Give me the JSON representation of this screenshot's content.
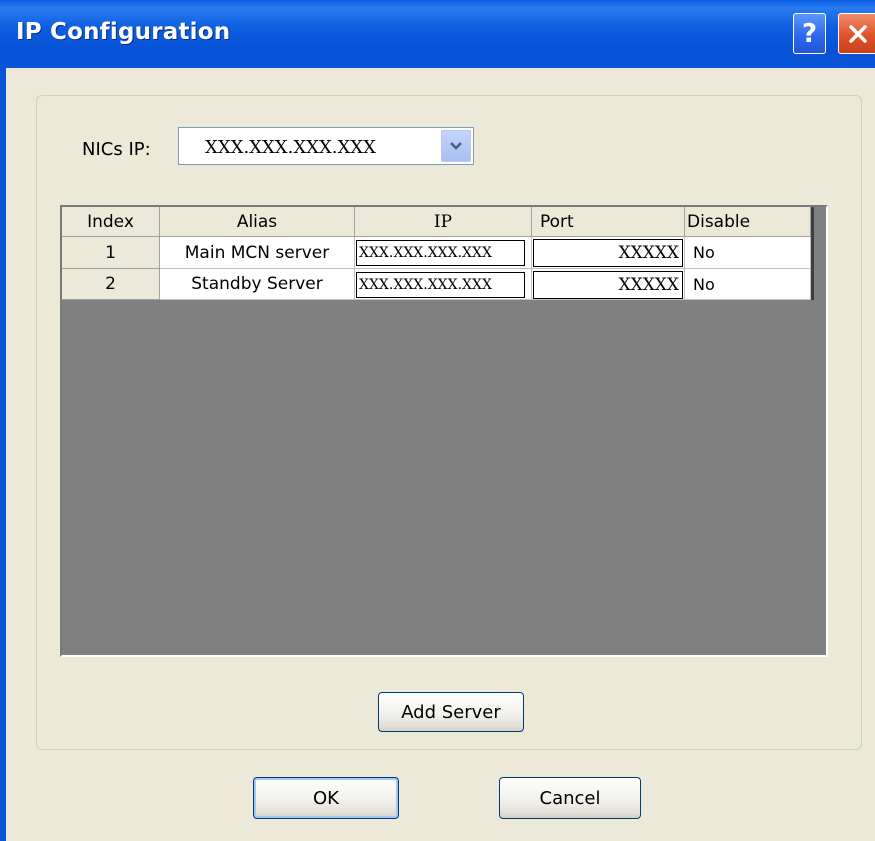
{
  "window": {
    "title": "IP Configuration",
    "help_glyph": "?"
  },
  "nics": {
    "label": "NICs IP:",
    "value": "XXX.XXX.XXX.XXX"
  },
  "grid": {
    "columns": [
      "Index",
      "Alias",
      "IP",
      "Port",
      "Disable"
    ],
    "rows": [
      {
        "index": "1",
        "alias": "Main MCN server",
        "ip": "XXX.XXX.XXX.XXX",
        "port": "XXXXX",
        "disable": "No"
      },
      {
        "index": "2",
        "alias": "Standby Server",
        "ip": "XXX.XXX.XXX.XXX",
        "port": "XXXXX",
        "disable": "No"
      }
    ]
  },
  "buttons": {
    "add_server": "Add Server",
    "ok": "OK",
    "cancel": "Cancel"
  },
  "icons": {
    "help": "help-icon",
    "close": "close-icon",
    "dropdown": "chevron-down-icon"
  },
  "colors": {
    "titlebar": "#0a56d8",
    "dialog_bg": "#ece9d8",
    "grid_bg": "#808080",
    "close_button": "#e0532a"
  }
}
